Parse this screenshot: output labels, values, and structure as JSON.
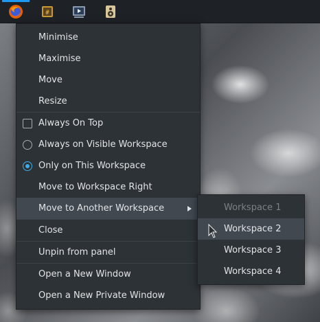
{
  "panel": {
    "tasks": [
      {
        "icon": "firefox-icon",
        "active": true
      },
      {
        "icon": "terminal-icon",
        "active": false
      },
      {
        "icon": "video-player-icon",
        "active": false
      },
      {
        "icon": "speaker-icon",
        "active": false
      }
    ]
  },
  "context_menu": {
    "items": [
      {
        "label": "Minimise"
      },
      {
        "label": "Maximise"
      },
      {
        "label": "Move"
      },
      {
        "label": "Resize"
      },
      {
        "label": "Always On Top",
        "type": "checkbox",
        "checked": false
      },
      {
        "label": "Always on Visible Workspace",
        "type": "radio",
        "checked": false
      },
      {
        "label": "Only on This Workspace",
        "type": "radio",
        "checked": true
      },
      {
        "label": "Move to Workspace Right"
      },
      {
        "label": "Move to Another Workspace",
        "submenu": true,
        "highlighted": true
      },
      {
        "label": "Close"
      },
      {
        "label": "Unpin from panel"
      },
      {
        "label": "Open a New Window"
      },
      {
        "label": "Open a New Private Window"
      }
    ]
  },
  "submenu": {
    "items": [
      {
        "label": "Workspace 1",
        "disabled": true
      },
      {
        "label": "Workspace 2",
        "highlighted": true
      },
      {
        "label": "Workspace 3"
      },
      {
        "label": "Workspace 4"
      }
    ]
  },
  "colors": {
    "accent": "#3daee9",
    "menu_bg": "#2d3237",
    "highlight_bg": "#414850",
    "panel_bg": "#1e2226"
  }
}
